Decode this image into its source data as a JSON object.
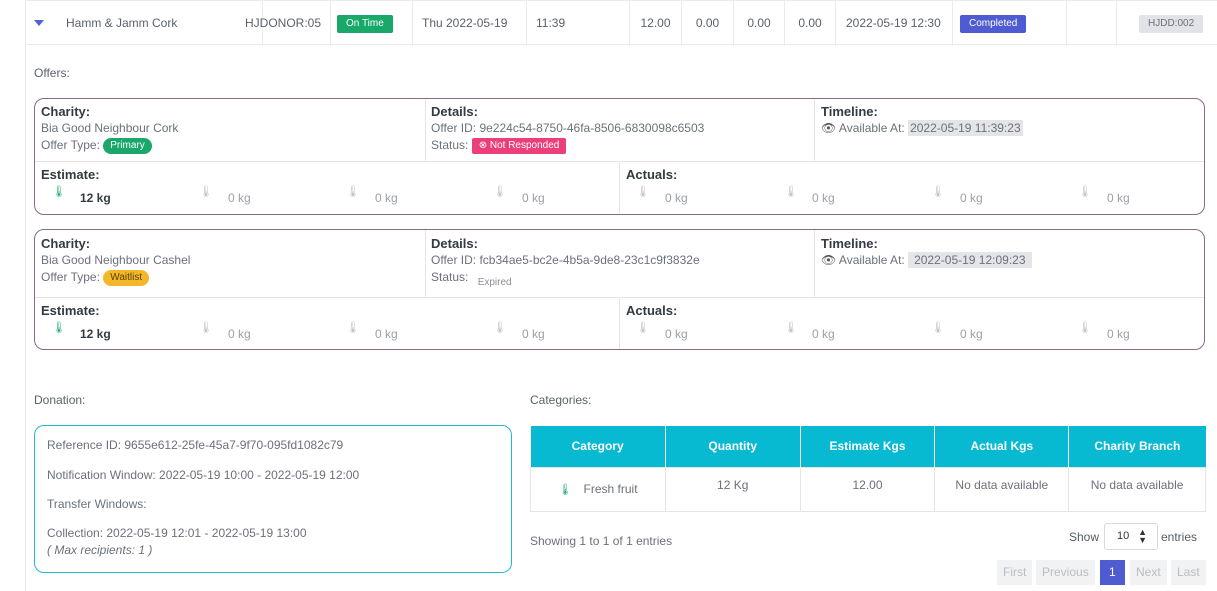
{
  "row": {
    "donor": "Hamm & Jamm Cork",
    "donor_code": "HJDONOR:05",
    "timeliness": "On Time",
    "date": "Thu 2022-05-19",
    "time": "11:39",
    "v1": "12.00",
    "v2": "0.00",
    "v3": "0.00",
    "v4": "0.00",
    "datetime": "2022-05-19 12:30",
    "status": "Completed",
    "code": "HJDD:002"
  },
  "offers_label": "Offers:",
  "offers": [
    {
      "charity_h": "Charity:",
      "charity": "Bia Good Neighbour Cork",
      "offer_type_label": "Offer Type:",
      "offer_type": "Primary",
      "details_h": "Details:",
      "offer_id": "Offer ID: 9e224c54-8750-46fa-8506-6830098c6503",
      "status_label": "Status:",
      "status": "Not Responded",
      "timeline_h": "Timeline:",
      "available_label": "Available At:",
      "available": "2022-05-19 11:39:23",
      "estimate_h": "Estimate:",
      "actuals_h": "Actuals:",
      "est": [
        "12 kg",
        "0 kg",
        "0 kg",
        "0 kg"
      ],
      "act": [
        "0 kg",
        "0 kg",
        "0 kg",
        "0 kg"
      ]
    },
    {
      "charity_h": "Charity:",
      "charity": "Bia Good Neighbour Cashel",
      "offer_type_label": "Offer Type:",
      "offer_type": "Waitlist",
      "details_h": "Details:",
      "offer_id": "Offer ID: fcb34ae5-bc2e-4b5a-9de8-23c1c9f3832e",
      "status_label": "Status:",
      "status": "Expired",
      "timeline_h": "Timeline:",
      "available_label": "Available At:",
      "available": "2022-05-19 12:09:23",
      "estimate_h": "Estimate:",
      "actuals_h": "Actuals:",
      "est": [
        "12 kg",
        "0 kg",
        "0 kg",
        "0 kg"
      ],
      "act": [
        "0 kg",
        "0 kg",
        "0 kg",
        "0 kg"
      ]
    }
  ],
  "donation": {
    "label": "Donation:",
    "reference": "Reference ID: 9655e612-25fe-45a7-9f70-095fd1082c79",
    "notification": "Notification Window: 2022-05-19 10:00 - 2022-05-19 12:00",
    "transfer": "Transfer Windows:",
    "collection": "Collection: 2022-05-19 12:01 - 2022-05-19 13:00",
    "max": "( Max recipients: 1 )"
  },
  "categories": {
    "label": "Categories:",
    "headers": [
      "Category",
      "Quantity",
      "Estimate Kgs",
      "Actual Kgs",
      "Charity Branch"
    ],
    "rows": [
      [
        "Fresh fruit",
        "12 Kg",
        "12.00",
        "No data available",
        "No data available"
      ]
    ],
    "info": "Showing 1 to 1 of 1 entries",
    "show_label": "Show",
    "page_size": "10",
    "entries_label": "entries",
    "pager": [
      "First",
      "Previous",
      "1",
      "Next",
      "Last"
    ]
  },
  "icons": {
    "caret": "chevron-down-icon",
    "eye": "eye-icon",
    "food_plus": "food-plus-icon",
    "food_minus": "food-minus-icon",
    "food_cold": "food-cold-icon",
    "food_waste": "food-waste-icon"
  },
  "colors": {
    "accent": "#4e5bd1",
    "teal": "#08b9d2",
    "green": "#1aa86a",
    "card_border": "#8b6a88",
    "red": "#ec3f7a",
    "yellow": "#f3b72a"
  }
}
